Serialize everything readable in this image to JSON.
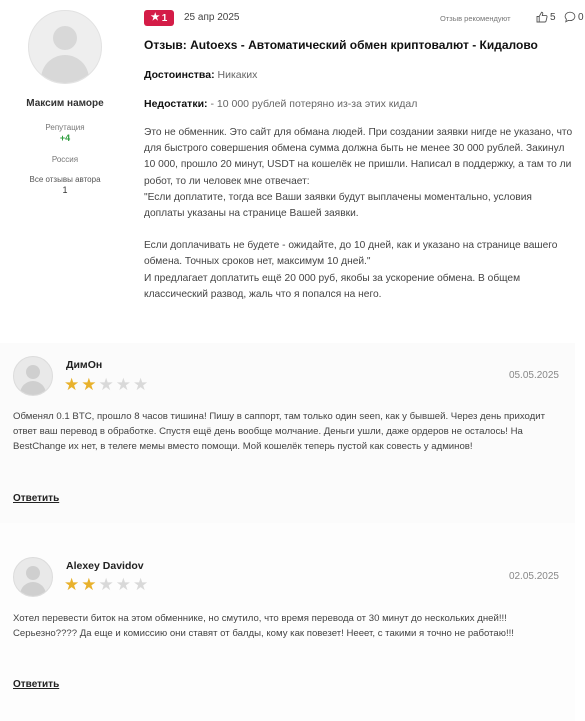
{
  "review": {
    "author": {
      "name": "Максим наморе",
      "reputation_label": "Репутация",
      "reputation_value": "+4",
      "country": "Россия",
      "all_reviews_label": "Все отзывы автора",
      "all_reviews_count": "1"
    },
    "rating": "1",
    "date": "25 апр 2025",
    "recommend_label": "Отзыв рекомендуют",
    "likes": "5",
    "comments": "0",
    "title": "Отзыв: Autoexs - Автоматический обмен криптовалют - Кидалово",
    "pros_label": "Достоинства:",
    "pros_text": "Никаких",
    "cons_label": "Недостатки:",
    "cons_text": "- 10 000 рублей потеряно из-за этих кидал",
    "body": [
      "Это не обменник. Это сайт для обмана людей. При создании заявки нигде не указано, что для быстрого совершения обмена сумма должна быть не менее 30 000 рублей. Закинул 10 000, прошло 20 минут, USDT на кошелёк не пришли. Написал в поддержку, а там то ли робот, то ли человек мне отвечает:",
      "\"Если доплатите, тогда все Ваши заявки будут выплачены моментально, условия доплаты указаны на странице Вашей заявки.",
      "Если доплачивать не будете - ожидайте, до 10 дней, как и указано на странице вашего обмена. Точных сроков нет, максимум 10 дней.\"",
      "И предлагает доплатить ещё 20 000 руб, якобы за ускорение обмена. В общем классический развод, жаль что я попался на него."
    ]
  },
  "comments": [
    {
      "name": "ДимОн",
      "stars": 2,
      "max_stars": 5,
      "date": "05.05.2025",
      "text": "Обменял 0.1 BTC, прошло 8 часов тишина! Пишу в саппорт, там только один seen, как у бывшей. Через день приходит ответ ваш перевод в обработке. Спустя ещё день вообще молчание. Деньги ушли, даже ордеров не осталось! На BestChange их нет, в телеге мемы вместо помощи. Мой кошелёк теперь пустой как совесть у админов!",
      "reply_label": "Ответить"
    },
    {
      "name": "Alexey Davidov",
      "stars": 2,
      "max_stars": 5,
      "date": "02.05.2025",
      "text": "Хотел перевести биток на этом обменнике, но смутило, что время перевода от 30 минут до нескольких дней!!! Серьезно???? Да еще и комиссию они ставят от балды, кому как повезет! Нееет, с такими я точно не работаю!!!",
      "reply_label": "Ответить"
    }
  ],
  "colors": {
    "rating_badge": "#d41c47",
    "star_filled": "#e8b12c",
    "star_empty": "#d9d9d9",
    "reputation": "#2e9e3e"
  },
  "icons": {
    "rating": "star-icon",
    "likes": "thumbs-up-icon",
    "comments": "comment-icon",
    "avatar": "user-avatar-icon"
  }
}
